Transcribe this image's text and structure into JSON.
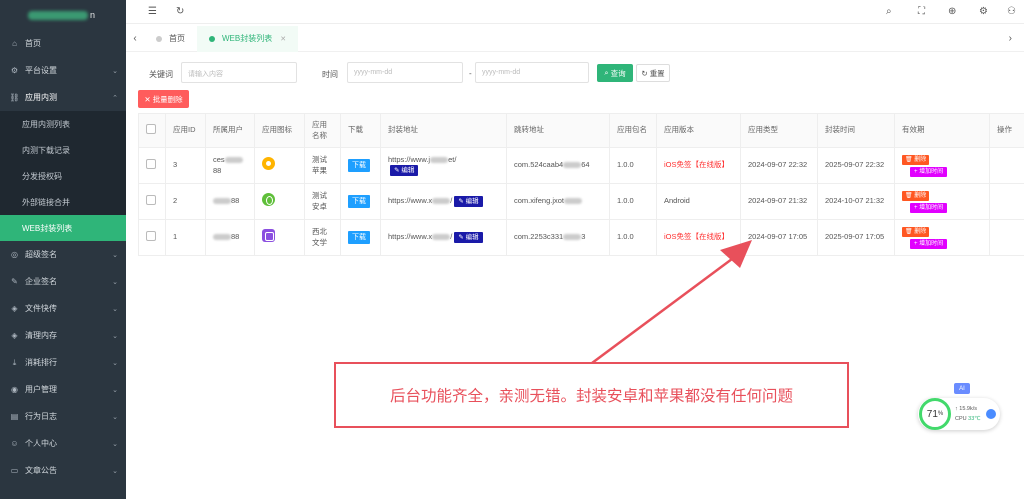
{
  "sidebar": {
    "logo_suffix": "n",
    "items": [
      {
        "label": "首页",
        "icon": "home-icon",
        "glyph": "⌂"
      },
      {
        "label": "平台设置",
        "icon": "gear-icon",
        "glyph": "⚙"
      },
      {
        "label": "应用内测",
        "icon": "link-icon",
        "glyph": "⛓"
      },
      {
        "label": "超级签名",
        "icon": "circle-icon",
        "glyph": "◎"
      },
      {
        "label": "企业签名",
        "icon": "edit-icon",
        "glyph": "✎"
      },
      {
        "label": "文件快传",
        "icon": "layers-icon",
        "glyph": "◈"
      },
      {
        "label": "清理内存",
        "icon": "layers-icon",
        "glyph": "◈"
      },
      {
        "label": "消耗排行",
        "icon": "download-icon",
        "glyph": "⤓"
      },
      {
        "label": "用户管理",
        "icon": "user-icon",
        "glyph": "◉"
      },
      {
        "label": "行为日志",
        "icon": "doc-icon",
        "glyph": "▤"
      },
      {
        "label": "个人中心",
        "icon": "smile-icon",
        "glyph": "☺"
      },
      {
        "label": "文章公告",
        "icon": "monitor-icon",
        "glyph": "▭"
      }
    ],
    "sub_items": [
      {
        "label": "应用内测列表"
      },
      {
        "label": "内测下载记录"
      },
      {
        "label": "分发授权码"
      },
      {
        "label": "外部链接合并"
      },
      {
        "label": "WEB封装列表"
      }
    ]
  },
  "tabs": [
    {
      "label": "首页"
    },
    {
      "label": "WEB封装列表"
    }
  ],
  "form": {
    "keyword_label": "关键词",
    "keyword_placeholder": "请输入内容",
    "time_label": "时间",
    "date_placeholder": "yyyy-mm-dd",
    "date_sep": "-",
    "search_label": "查询",
    "reset_label": "重置",
    "batch_delete_label": "批量删除"
  },
  "table": {
    "headers": [
      "应用ID",
      "所属用户",
      "应用图标",
      "应用名称",
      "下载",
      "封装地址",
      "跳转地址",
      "应用包名",
      "应用版本",
      "应用类型",
      "封装时间",
      "有效期",
      "操作"
    ],
    "download_label": "下载",
    "edit_label": "编辑",
    "delete_label": "删除",
    "add_time_label": "+ 增加时间",
    "rows": [
      {
        "id": "3",
        "user_a": "ces",
        "user_b": "88",
        "icon": "app-icon-orange",
        "name": "测试苹果",
        "url_a": "https://www.j",
        "url_b": "et/",
        "jump_a": "com.524caab4",
        "jump_b": "64",
        "pkg": "1.0.0",
        "version": "iOS免签【在线版】",
        "type": "2024-09-07 22:32",
        "time": "2025-09-07 22:32"
      },
      {
        "id": "2",
        "user_a": "",
        "user_b": "88",
        "icon": "app-icon-green",
        "name": "测试安卓",
        "url_a": "https://www.x",
        "url_b": "/",
        "jump_a": "com.xifeng.jxot",
        "jump_b": "",
        "pkg": "1.0.0",
        "version": "Android",
        "type": "2024-09-07 21:32",
        "time": "2024-10-07 21:32"
      },
      {
        "id": "1",
        "user_a": "",
        "user_b": "88",
        "icon": "app-icon-purple",
        "name": "西北文学",
        "url_a": "https://www.x",
        "url_b": "/",
        "jump_a": "com.2253c331",
        "jump_b": "3",
        "pkg": "1.0.0",
        "version": "iOS免签【在线版】",
        "type": "2024-09-07 17:05",
        "time": "2025-09-07 17:05"
      }
    ]
  },
  "annotation": {
    "text": "后台功能齐全，亲测无错。封装安卓和苹果都没有任何问题"
  },
  "widget": {
    "ai_label": "AI",
    "percent": "71",
    "percent_unit": "%",
    "net": "15.9k/s",
    "cpu_label": "CPU",
    "cpu_temp": "33℃"
  },
  "colors": {
    "sidebar_bg": "#2b3640",
    "accent": "#2fb579",
    "annotation": "#e8505b",
    "edit": "#1a1aa8",
    "add_time": "#e100ff",
    "delete": "#ff5722"
  }
}
